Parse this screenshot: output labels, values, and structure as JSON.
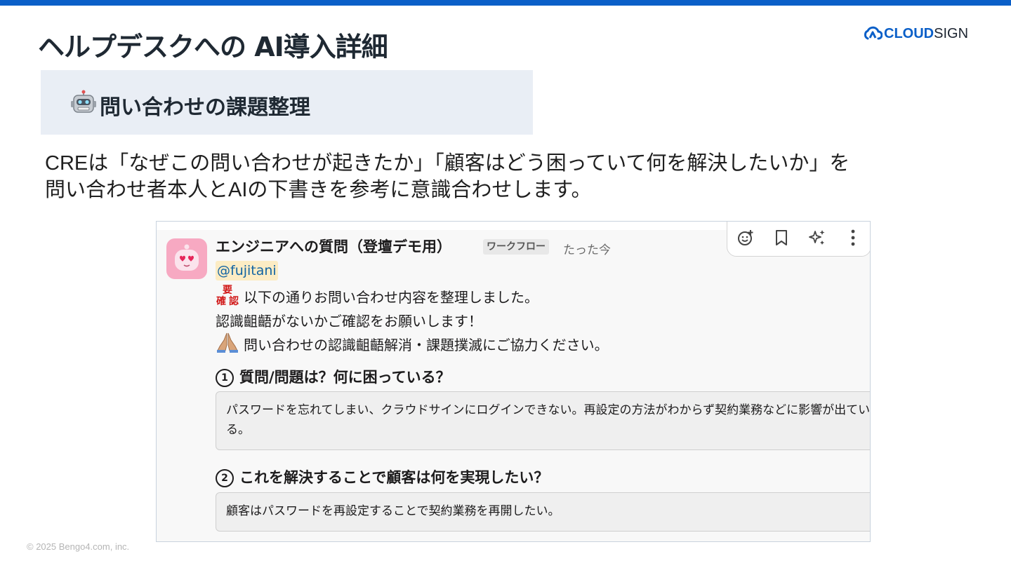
{
  "slide": {
    "title": "ヘルプデスクへの AI導入詳細",
    "section_title": "問い合わせの課題整理",
    "section_icon": "robot-icon",
    "description_line1": "CREは「なぜこの問い合わせが起きたか」「顧客はどう困っていて何を解決したいか」を",
    "description_line2": "問い合わせ者本人とAIの下書きを参考に意識合わせします。",
    "footer": "© 2025 Bengo4.com, inc.",
    "accent_color": "#0a5fc8"
  },
  "brand": {
    "name_part1": "CLOUD",
    "name_part2": "SIGN",
    "icon": "cloudsign-logo-icon"
  },
  "message": {
    "sender": "エンジニアへの質問（登壇デモ用）",
    "badge": "ワークフロー",
    "timestamp": "たった今",
    "mention": "@fujitani",
    "need_emoji_text": "要確認",
    "line1": "以下の通りお問い合わせ内容を整理しました。",
    "line2": "認識齟齬がないかご確認をお願いします！",
    "line3": "問い合わせの認識齟齬解消・課題撲滅にご協力ください。",
    "q1_number": "1",
    "q1_heading": "質問/問題は？何に困っている？",
    "q1_answer": "パスワードを忘れてしまい、クラウドサインにログインできない。再設定の方法がわからず契約業務などに影響が出ている。",
    "q2_number": "2",
    "q2_heading": "これを解決することで顧客は何を実現したい？",
    "q2_answer": "顧客はパスワードを再設定することで契約業務を再開したい。"
  },
  "actions": [
    "add-reaction-icon",
    "bookmark-icon",
    "ai-sparkle-icon",
    "more-vertical-icon"
  ]
}
